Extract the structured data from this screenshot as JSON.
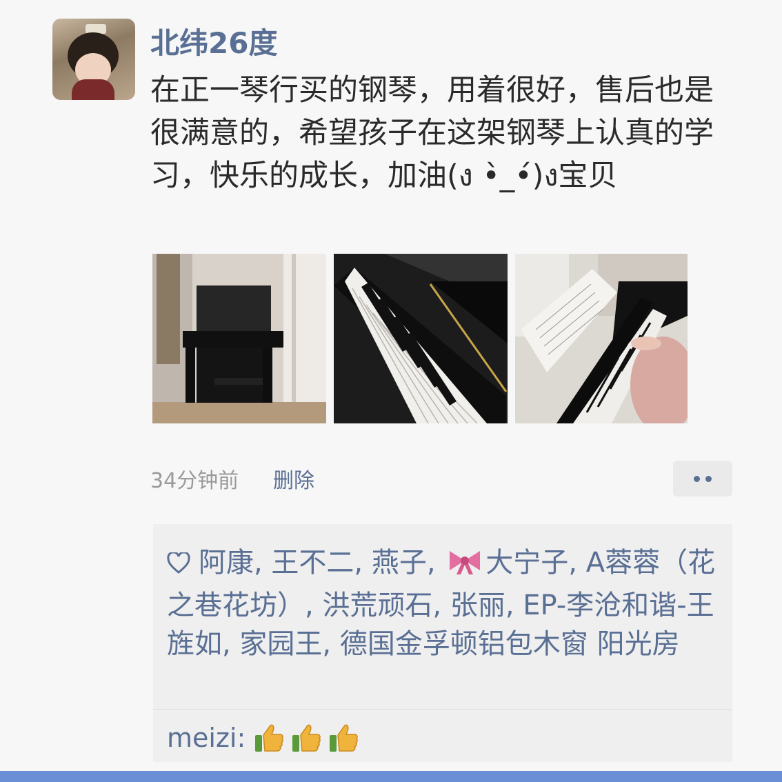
{
  "post": {
    "username": "北纬26度",
    "text": "在正一琴行买的钢琴，用着很好，售后也是很满意的，希望孩子在这架钢琴上认真的学习，快乐的成长，加油(ง •̀_•́)ง宝贝",
    "photo_count": 3
  },
  "meta": {
    "timestamp": "34分钟前",
    "delete_label": "删除",
    "more_icon": "more-dots-icon"
  },
  "likes": {
    "icon": "heart-icon",
    "part1": "阿康, 王不二, 燕子, ",
    "bow_icon": "bow-icon",
    "part2": "大宁子, A蓉蓉（花之巷花坊）, 洪荒顽石, 张丽, EP-李沧和谐-王旌如, 家园王, 德国金孚顿铝包木窗  阳光房"
  },
  "comment": {
    "user": "meizi",
    "colon": ":",
    "emoji": [
      "thumbs-up-icon",
      "thumbs-up-icon",
      "thumbs-up-icon"
    ]
  },
  "colors": {
    "name_link": "#5a6f94",
    "text": "#2a2a2a",
    "muted": "#9a9a9a",
    "background": "#f7f7f7",
    "comment_box": "#efefef",
    "bottom_bar": "#6b8fd6"
  }
}
